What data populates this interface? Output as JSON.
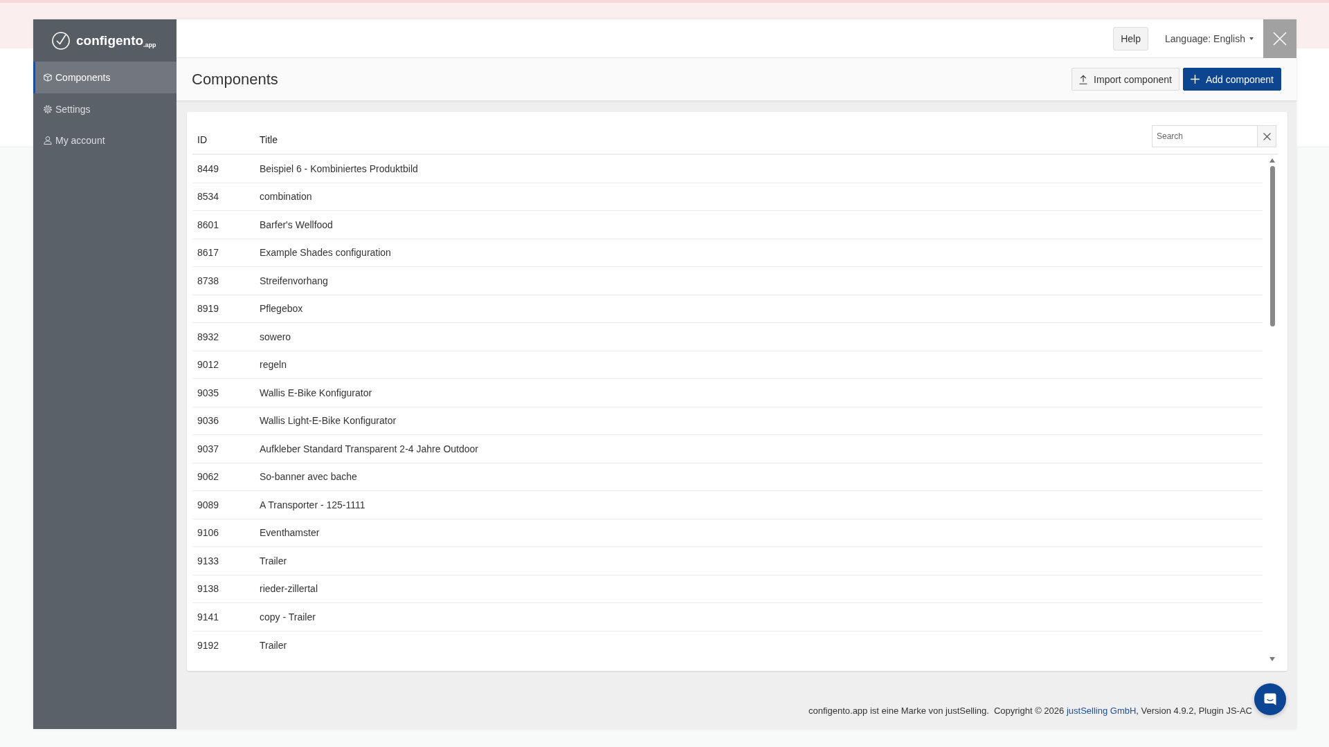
{
  "logo": {
    "text": "configento$_{.app}$"
  },
  "sidebar": {
    "items": [
      {
        "label": "Components",
        "selected": true
      },
      {
        "label": "Settings",
        "selected": false
      },
      {
        "label": "My account",
        "selected": false
      }
    ]
  },
  "topbar": {
    "help_button": "Help",
    "language_menu": "Language: English"
  },
  "page": {
    "title": "Components",
    "buttons": [
      {
        "label": "Import component",
        "kind": "secondary"
      },
      {
        "label": "Add component",
        "kind": "primary"
      }
    ]
  },
  "table": {
    "columns": [
      "ID",
      "Title"
    ],
    "search": {
      "placeholder": "Search"
    },
    "rows": [
      [
        "8449",
        "Beispiel 6 - Kombiniertes Produktbild"
      ],
      [
        "8534",
        "combination"
      ],
      [
        "8601",
        "Barfer's Wellfood"
      ],
      [
        "8617",
        "Example Shades configuration"
      ],
      [
        "8738",
        "Streifenvorhang"
      ],
      [
        "8919",
        "Pflegebox"
      ],
      [
        "8932",
        "sowero"
      ],
      [
        "9012",
        "regeln"
      ],
      [
        "9035",
        "Wallis E-Bike Konfigurator"
      ],
      [
        "9036",
        "Wallis Light-E-Bike Konfigurator"
      ],
      [
        "9037",
        "Aufkleber Standard Transparent 2-4 Jahre Outdoor"
      ],
      [
        "9062",
        "So-banner avec bache"
      ],
      [
        "9089",
        "A Transporter - 125-1111"
      ],
      [
        "9106",
        "Eventhamster"
      ],
      [
        "9133",
        "Trailer"
      ],
      [
        "9138",
        "rieder-zillertal"
      ],
      [
        "9141",
        "copy - Trailer"
      ],
      [
        "9192",
        "Trailer"
      ]
    ]
  },
  "footer": {
    "trademark": "configento.app ist eine Marke von justSelling.",
    "copyright": "Copyright © 2026",
    "link": "justSelling GmbH",
    "version": ", Version 4.9.2, Plugin JS-AC"
  }
}
